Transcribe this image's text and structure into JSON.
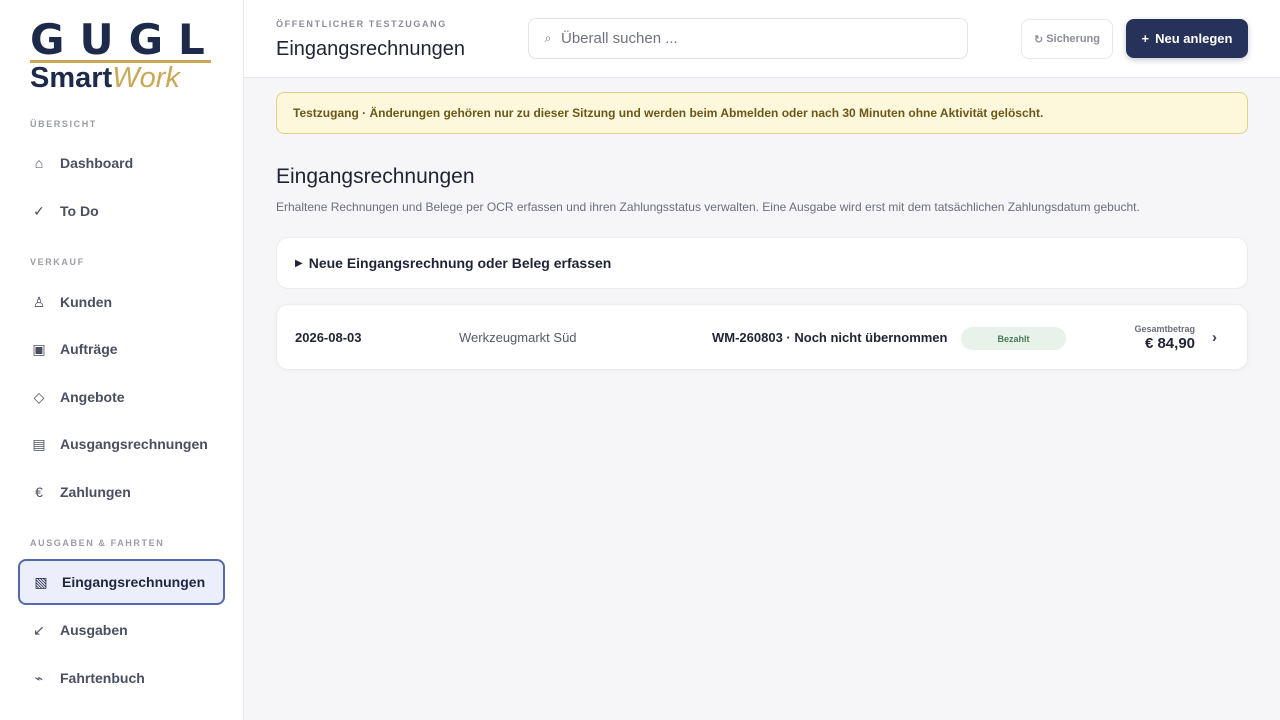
{
  "brand": {
    "top": "GUGL",
    "bottom_a": "Smart",
    "bottom_b": "Work"
  },
  "sidebar": {
    "sections": [
      {
        "label": "ÜBERSICHT"
      },
      {
        "label": "VERKAUF"
      },
      {
        "label": "AUSGABEN & FAHRTEN"
      }
    ],
    "items": [
      {
        "label": "Dashboard",
        "icon": "home-icon",
        "glyph": "⌂"
      },
      {
        "label": "To Do",
        "icon": "check-icon",
        "glyph": "✓"
      },
      {
        "label": "Kunden",
        "icon": "user-icon",
        "glyph": "♙"
      },
      {
        "label": "Aufträge",
        "icon": "orders-icon",
        "glyph": "▣"
      },
      {
        "label": "Angebote",
        "icon": "diamond-icon",
        "glyph": "◇"
      },
      {
        "label": "Ausgangsrechnungen",
        "icon": "invoice-out-icon",
        "glyph": "▤"
      },
      {
        "label": "Zahlungen",
        "icon": "euro-icon",
        "glyph": "€"
      },
      {
        "label": "Eingangsrechnungen",
        "icon": "invoice-in-icon",
        "glyph": "▧"
      },
      {
        "label": "Ausgaben",
        "icon": "arrow-down-left-icon",
        "glyph": "↙"
      },
      {
        "label": "Fahrtenbuch",
        "icon": "route-icon",
        "glyph": "⌁"
      }
    ],
    "active": "Eingangsrechnungen"
  },
  "header": {
    "eyebrow": "ÖFFENTLICHER TESTZUGANG",
    "title": "Eingangsrechnungen",
    "search_placeholder": "Überall suchen ...",
    "backup_label": "Sicherung",
    "backup_glyph": "↻",
    "new_label": "Neu anlegen",
    "new_glyph": "+"
  },
  "banner": {
    "text": "Testzugang · Änderungen gehören nur zu dieser Sitzung und werden beim Abmelden oder nach 30 Minuten ohne Aktivität gelöscht."
  },
  "main": {
    "title": "Eingangsrechnungen",
    "subtitle": "Erhaltene Rechnungen und Belege per OCR erfassen und ihren Zahlungsstatus verwalten. Eine Ausgabe wird erst mit dem tatsächlichen Zahlungsdatum gebucht.",
    "new_entry_label": "Neue Eingangsrechnung oder Beleg erfassen",
    "new_entry_glyph": "▶",
    "rows": [
      {
        "date": "2026-08-03",
        "vendor": "Werkzeugmarkt Süd",
        "reference": "WM-260803 · Noch nicht übernommen",
        "status": "Bezahlt",
        "total_label": "Gesamtbetrag",
        "total": "€ 84,90",
        "chevron": "›"
      }
    ]
  },
  "colors": {
    "accent": "#27325a",
    "gold": "#c9a955",
    "active_border": "#5668ad",
    "banner_bg": "#fdf7dc",
    "status_paid_bg": "#e6f2ea"
  }
}
